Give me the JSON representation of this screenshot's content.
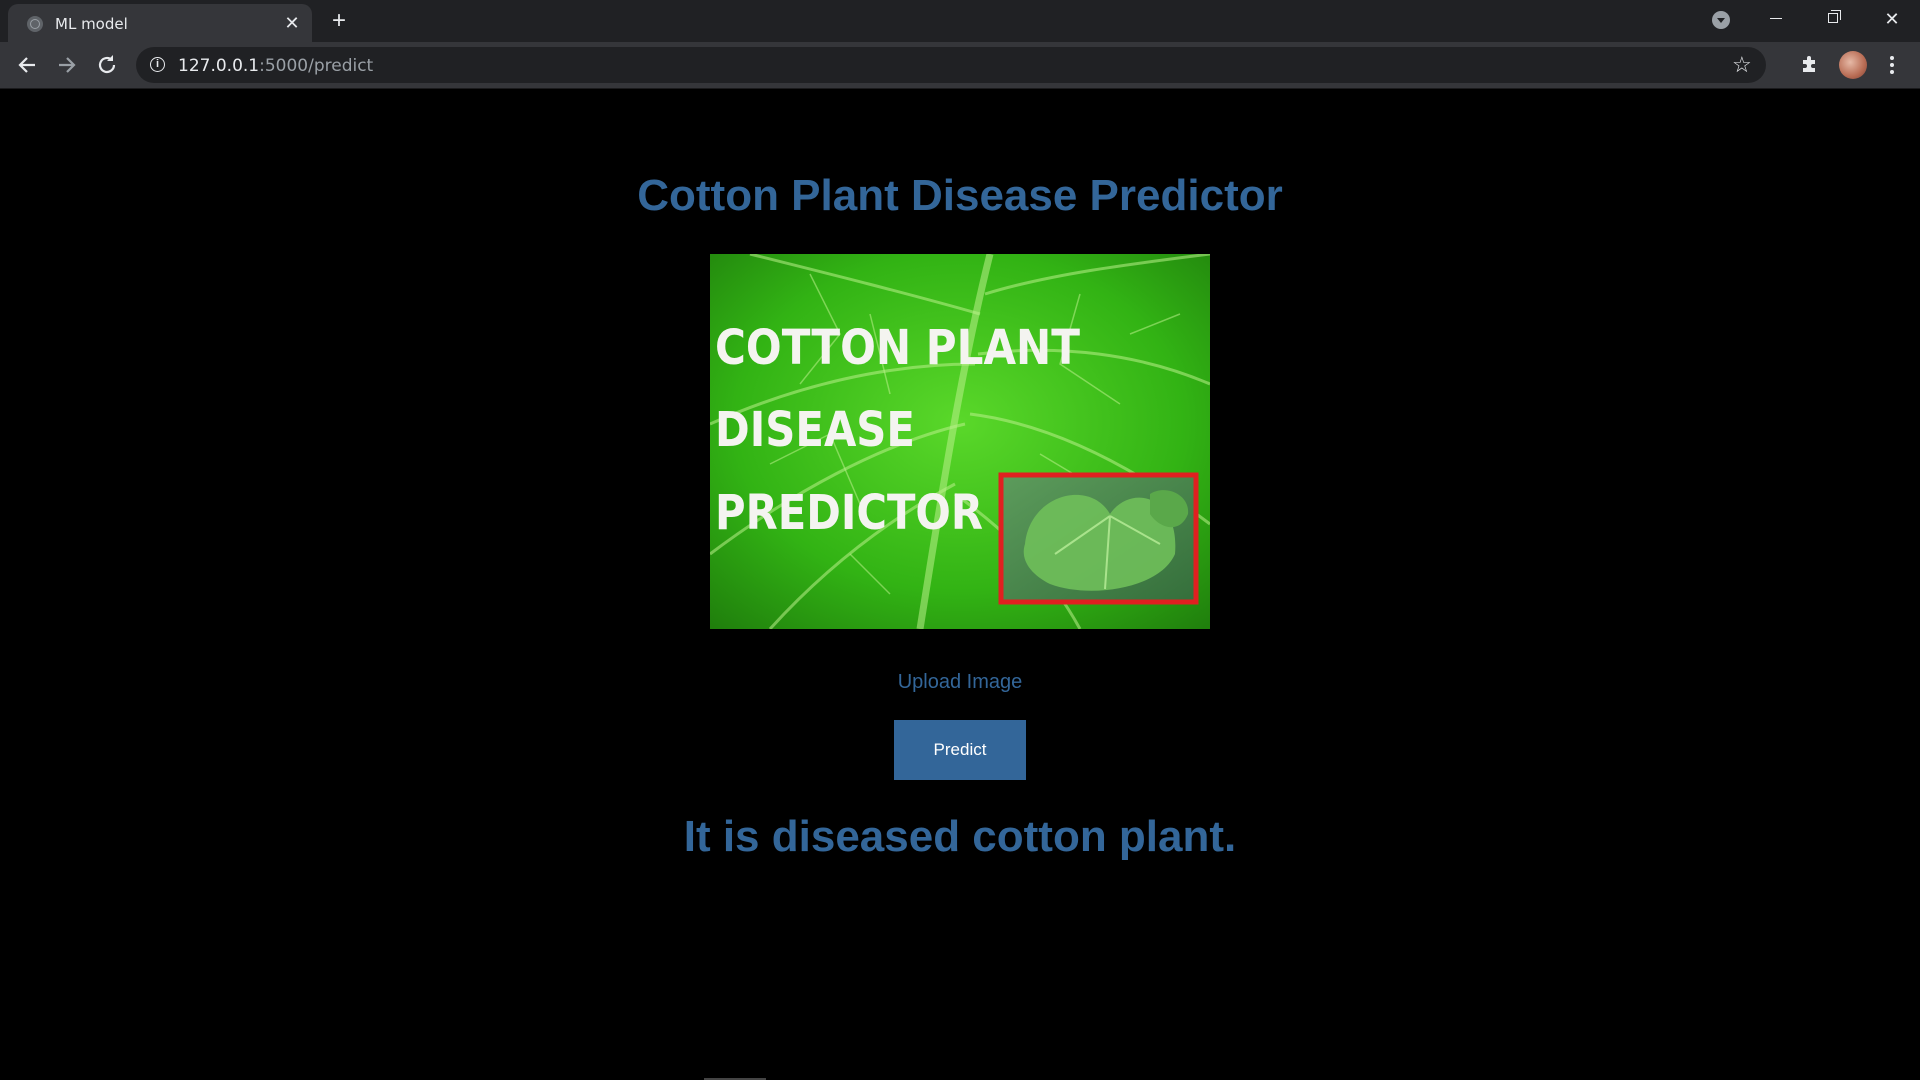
{
  "browser": {
    "tab_title": "ML model",
    "url_host": "127.0.0.1",
    "url_path": ":5000/predict"
  },
  "page": {
    "heading": "Cotton Plant Disease Predictor",
    "banner_text": [
      "COTTON PLANT",
      "DISEASE",
      "PREDICTOR"
    ],
    "upload_label": "Upload Image",
    "predict_label": "Predict",
    "result": "It is diseased cotton plant."
  },
  "colors": {
    "accent": "#336699",
    "background": "#000000",
    "leaf_green": "#3cbf1c",
    "highlight_box": "#e02020"
  },
  "icons": [
    "globe-icon",
    "close-icon",
    "plus-icon",
    "tab-search-icon",
    "minimize-icon",
    "restore-icon",
    "window-close-icon",
    "back-arrow-icon",
    "forward-arrow-icon",
    "reload-icon",
    "info-icon",
    "star-icon",
    "puzzle-icon",
    "avatar",
    "kebab-menu-icon"
  ]
}
